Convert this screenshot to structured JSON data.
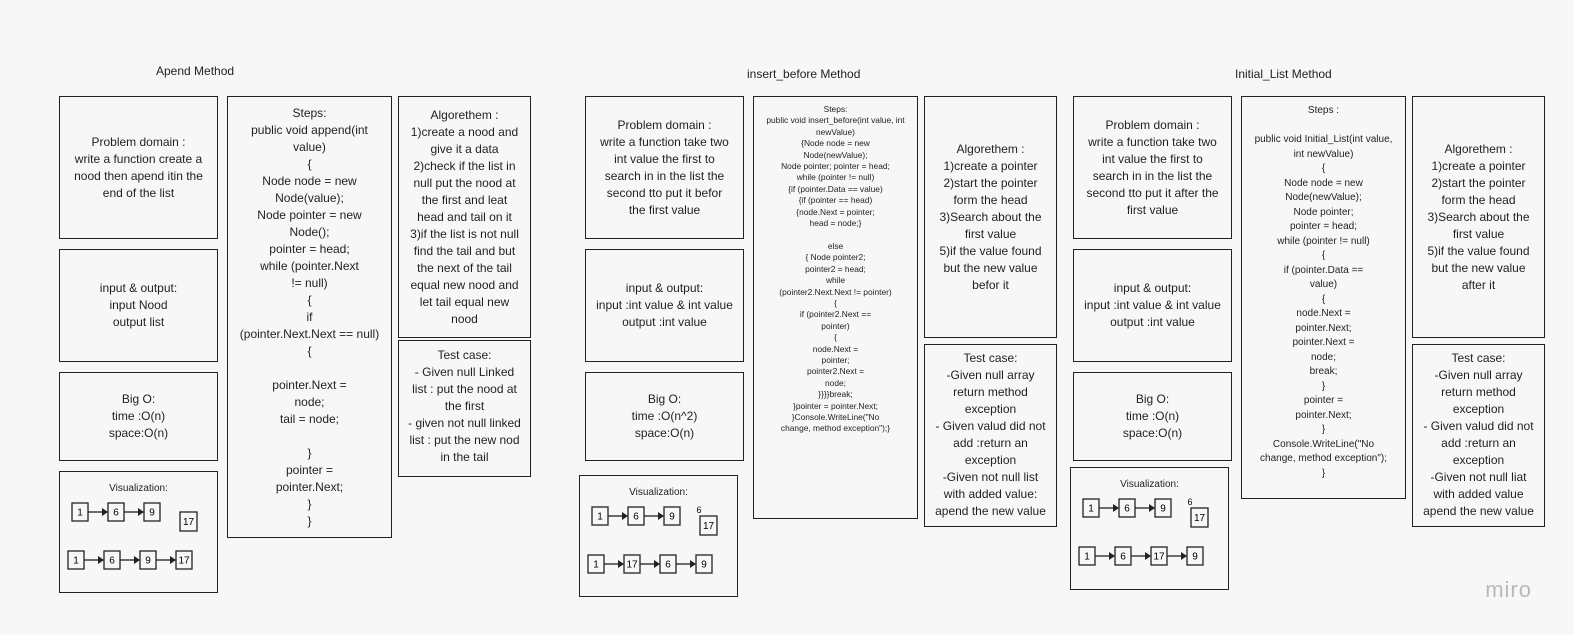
{
  "sections": [
    {
      "title": "Apend Method",
      "problem": [
        "Problem domain :",
        "write a function create a",
        "nood then apend itin the",
        "end of the list"
      ],
      "io": [
        "input & output:",
        "input Nood",
        "output list"
      ],
      "bigo": [
        "Big O:",
        "time :O(n)",
        "space:O(n)"
      ],
      "steps": [
        "Steps:",
        "public void append(int",
        "value)",
        "{",
        "Node node = new",
        "Node(value);",
        "Node pointer = new",
        "Node();",
        "pointer = head;",
        "while (pointer.Next",
        "!= null)",
        "{",
        "if",
        "(pointer.Next.Next == null)",
        "{",
        "",
        "pointer.Next =",
        "node;",
        "tail = node;",
        "",
        "}",
        "pointer =",
        "pointer.Next;",
        "}",
        "}"
      ],
      "algo": [
        "Algorethem :",
        "1)create a nood and",
        "give it a data",
        "2)check if the list in",
        "null put the nood at",
        "the first and leat",
        "head and tail on it",
        "3)if the list is not null",
        "find the tail and but",
        "the next of the tail",
        "equal new nood and",
        "let tail equal new",
        "nood"
      ],
      "test": [
        "Test case:",
        "- Given null Linked",
        "list : put the nood at",
        "the first",
        "- given not null linked",
        "list : put the new nod",
        "in the tail"
      ],
      "viz": {
        "title": "Visualization:",
        "row1": [
          "1",
          "6",
          "9"
        ],
        "extra": "17",
        "extra_label": "",
        "row2": [
          "1",
          "6",
          "9",
          "17"
        ]
      }
    },
    {
      "title": "insert_before Method",
      "problem": [
        "Problem domain :",
        "write a function take two",
        "int value the first to",
        "search in in the list the",
        "second tto put it befor",
        "the first value"
      ],
      "io": [
        "input & output:",
        "input :int value & int value",
        "output :int value"
      ],
      "bigo": [
        "Big O:",
        "time :O(n^2)",
        "space:O(n)"
      ],
      "steps": [
        "Steps:",
        "public void insert_before(int value, int",
        "newValue)",
        "{Node node = new",
        "Node(newValue);",
        "Node pointer; pointer = head;",
        "while (pointer != null)",
        "{if (pointer.Data == value)",
        "{if (pointer == head)",
        "{node.Next = pointer;",
        "head = node;}",
        "",
        "else",
        "{ Node pointer2;",
        "pointer2 = head;",
        "while",
        "(pointer2.Next.Next != pointer)",
        "{",
        "if (pointer2.Next ==",
        "pointer)",
        "{",
        "node.Next =",
        "pointer;",
        "pointer2.Next =",
        "node;",
        "}}}}break;",
        "}pointer = pointer.Next;",
        "}Console.WriteLine(\"No",
        "change, method exception\");}"
      ],
      "algo": [
        "Algorethem :",
        "1)create a pointer",
        "2)start the pointer",
        "form the head",
        "3)Search about the",
        "first value",
        "5)if the value found",
        "but the new value",
        "befor it"
      ],
      "test": [
        "Test case:",
        "-Given null array",
        "return method",
        "exception",
        "- Given valud did not",
        "add :return an",
        "exception",
        "-Given not null list",
        "with added value:",
        "apend the new value"
      ],
      "viz": {
        "title": "Visualization:",
        "row1": [
          "1",
          "6",
          "9"
        ],
        "extra": "17",
        "extra_label": "6",
        "row2": [
          "1",
          "17",
          "6",
          "9"
        ]
      }
    },
    {
      "title": "Initial_List  Method",
      "problem": [
        "Problem domain :",
        "write a function take two",
        "int value the first to",
        "search in in the list the",
        "second tto put it after the",
        "first value"
      ],
      "io": [
        "input & output:",
        "input :int value & int value",
        "output :int value"
      ],
      "bigo": [
        "Big O:",
        "time :O(n)",
        "space:O(n)"
      ],
      "steps": [
        "Steps :",
        "",
        "public void Initial_List(int value,",
        "int newValue)",
        "{",
        "Node node = new",
        "Node(newValue);",
        "Node pointer;",
        "pointer = head;",
        "while (pointer != null)",
        "{",
        "if (pointer.Data ==",
        "value)",
        "{",
        "node.Next =",
        "pointer.Next;",
        "pointer.Next =",
        "node;",
        "break;",
        "}",
        "pointer =",
        "pointer.Next;",
        "}",
        "Console.WriteLine(\"No",
        "change, method exception\");",
        "}"
      ],
      "algo": [
        "Algorethem :",
        "1)create a pointer",
        "2)start the pointer",
        "form the head",
        "3)Search about the",
        "first value",
        "5)if the value found",
        "but the new value",
        "after it"
      ],
      "test": [
        "Test case:",
        "-Given null array",
        "return method",
        "exception",
        "- Given valud did not",
        "add :return an",
        "exception",
        "-Given not null liat",
        "with added value",
        "apend the new value"
      ],
      "viz": {
        "title": "Visualization:",
        "row1": [
          "1",
          "6",
          "9"
        ],
        "extra": "17",
        "extra_label": "6",
        "row2": [
          "1",
          "6",
          "17",
          "9"
        ]
      }
    }
  ],
  "brand": {
    "logo": "miro"
  }
}
